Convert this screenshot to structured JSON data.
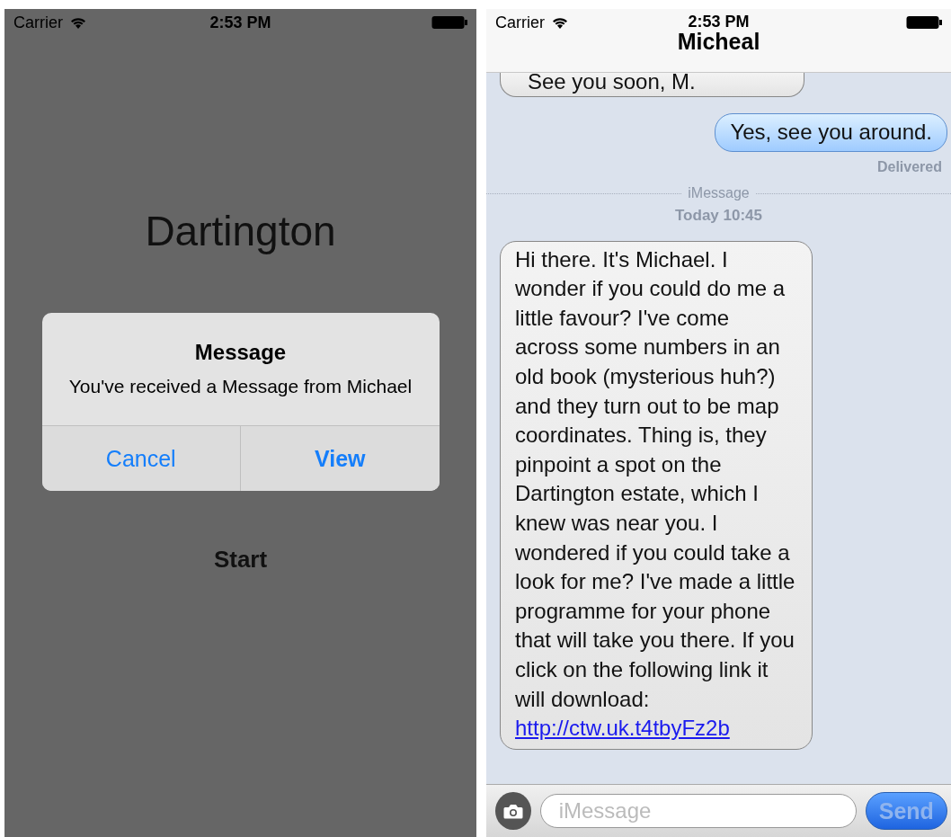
{
  "left_screen": {
    "status_bar": {
      "carrier": "Carrier",
      "time": "2:53 PM"
    },
    "title": "Dartington",
    "alert": {
      "title": "Message",
      "message": "You've received a Message from Michael",
      "buttons": [
        {
          "label": "Cancel",
          "kind": "cancel"
        },
        {
          "label": "View",
          "kind": "preferred"
        }
      ]
    },
    "start_label": "Start"
  },
  "right_screen": {
    "status_bar": {
      "carrier": "Carrier",
      "time": "2:53 PM"
    },
    "contact": "Micheal",
    "messages": [
      {
        "kind": "received",
        "text": "See you soon, M."
      },
      {
        "kind": "sent",
        "text": "Yes, see you around.",
        "status": "Delivered"
      },
      {
        "kind": "separator",
        "service": "iMessage",
        "time": "Today 10:45"
      },
      {
        "kind": "received",
        "text": "Hi there. It's Michael. I wonder if you could do me a little favour? I've come across some numbers in an old book (mysterious huh?) and they turn out to be map coordinates. Thing is, they pinpoint a spot on the Dartington estate, which I knew was near you. I wondered if you could take a look for me? I've made a little programme for your phone that will take you there. If you click on the following link it will download:",
        "link": "http://ctw.uk.t4tbyFz2b"
      }
    ],
    "input": {
      "placeholder": "iMessage"
    },
    "send": {
      "label": "Send",
      "disabled": true
    }
  }
}
